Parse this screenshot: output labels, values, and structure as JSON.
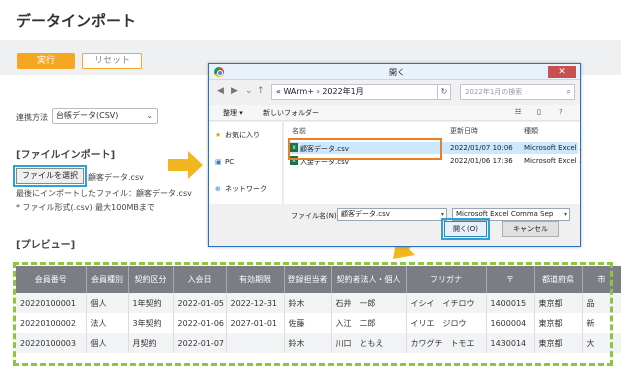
{
  "page": {
    "title": "データインポート",
    "run_label": "実行",
    "reset_label": "リセット"
  },
  "form": {
    "linkage_label": "連携方法",
    "linkage_value": "台帳データ(CSV)",
    "file_import_heading": "[ファイルインポート]",
    "choose_file_label": "ファイルを選択",
    "chosen_file": "顧客データ.csv",
    "last_import": "最後にインポートしたファイル：顧客データ.csv",
    "file_format": "* ファイル形式(.csv) 最大100MBまで",
    "preview_heading": "[プレビュー]"
  },
  "dialog": {
    "title": "開く",
    "address": "«  WArm+  ›  2022年1月",
    "search_placeholder": "2022年1月の検索",
    "organize": "整理 ▾",
    "new_folder": "新しいフォルダー",
    "nav_items": [
      "お気に入り",
      "PC",
      "ネットワーク"
    ],
    "col_name": "名前",
    "col_date": "更新日時",
    "col_type": "種類",
    "files": [
      {
        "name": "顧客データ.csv",
        "date": "2022/01/07 10:06",
        "type": "Microsoft Excel ..."
      },
      {
        "name": "入金データ.csv",
        "date": "2022/01/06 17:36",
        "type": "Microsoft Excel ..."
      }
    ],
    "filename_label": "ファイル名(N):",
    "filename_value": "顧客データ.csv",
    "filetype_value": "Microsoft Excel Comma Sep",
    "open_label": "開く(O)",
    "cancel_label": "キャンセル"
  },
  "table": {
    "headers": [
      "会員番号",
      "会員種別",
      "契約区分",
      "入会日",
      "有効期限",
      "登録担当者",
      "契約者法人・個人",
      "フリガナ",
      "〒",
      "都道府県",
      "市"
    ],
    "rows": [
      [
        "20220100001",
        "個人",
        "1年契約",
        "2022-01-05",
        "2022-12-31",
        "鈴木",
        "石井　一郎",
        "イシイ　イチロウ",
        "1400015",
        "東京都",
        "品"
      ],
      [
        "20220100002",
        "法人",
        "3年契約",
        "2022-01-06",
        "2027-01-01",
        "佐藤",
        "入江　二郎",
        "イリエ　ジロウ",
        "1600004",
        "東京都",
        "新"
      ],
      [
        "20220100003",
        "個人",
        "月契約",
        "2022-01-07",
        "",
        "鈴木",
        "川口　ともえ",
        "カワグチ　トモエ",
        "1430014",
        "東京都",
        "大"
      ]
    ]
  },
  "colors": {
    "accent_orange": "#f5a623",
    "highlight_blue": "#29a3d8",
    "highlight_orange": "#e8802a",
    "frame_green": "#8cc63f",
    "table_header": "#7a7d83"
  }
}
